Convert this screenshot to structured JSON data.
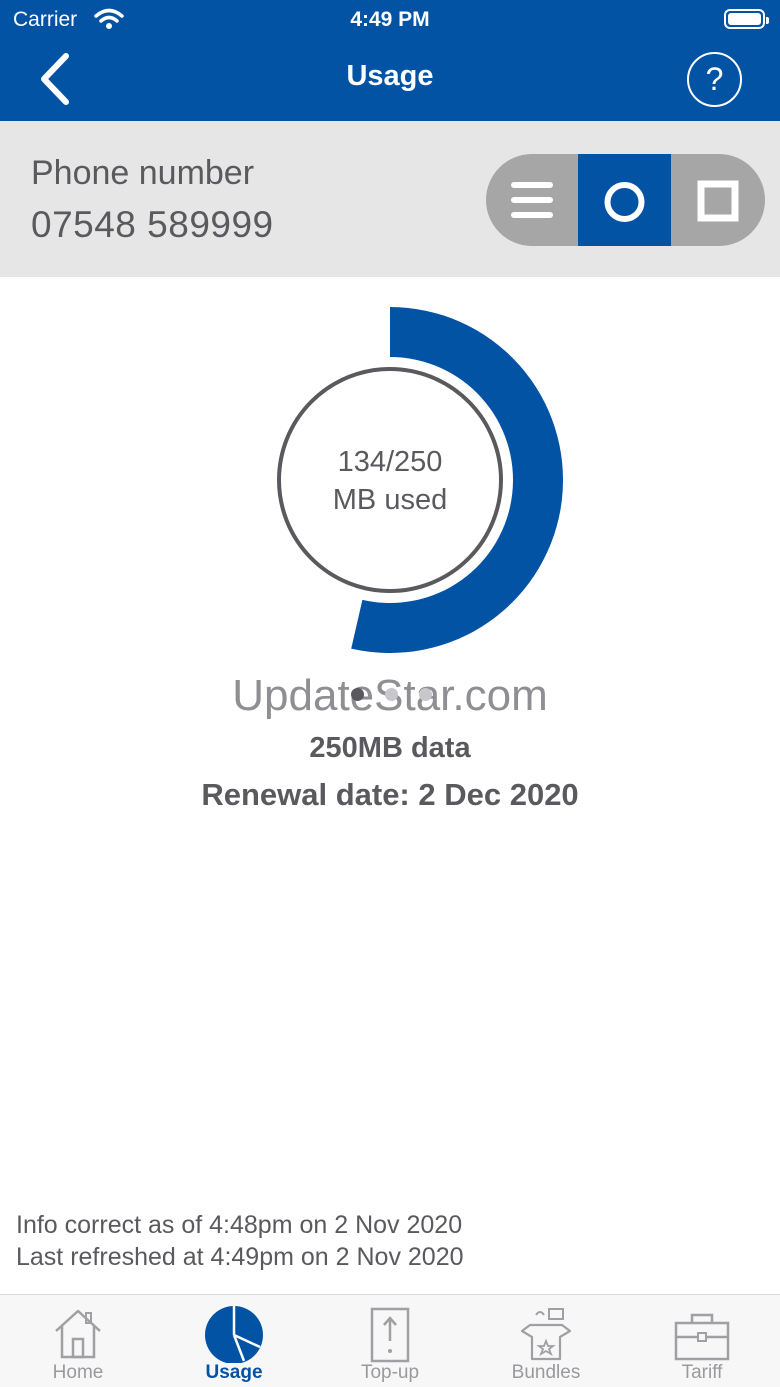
{
  "status_bar": {
    "carrier": "Carrier",
    "time": "4:49 PM"
  },
  "nav": {
    "title": "Usage",
    "back_icon": "chevron-left-icon",
    "help_label": "?"
  },
  "phone": {
    "label": "Phone number",
    "number": "07548 589999"
  },
  "view_toggle": {
    "options": [
      "list-view",
      "circle-view",
      "square-view"
    ],
    "selected": "circle-view"
  },
  "usage": {
    "used": 134,
    "total": 250,
    "fraction_used": 0.536,
    "center_line1": "134/250",
    "center_line2": "MB used",
    "accent_color": "#0353a4"
  },
  "watermark": "UpdateStar.com",
  "pager": {
    "count": 3,
    "active_index": 0
  },
  "plan": {
    "name": "250MB data",
    "renewal": "Renewal date: 2 Dec 2020"
  },
  "info": {
    "correct_as_of": "Info correct as of 4:48pm on 2 Nov 2020",
    "last_refreshed": "Last refreshed at 4:49pm on 2 Nov 2020"
  },
  "tabs": [
    {
      "label": "Home",
      "icon": "home-icon",
      "active": false
    },
    {
      "label": "Usage",
      "icon": "pie-chart-icon",
      "active": true
    },
    {
      "label": "Top-up",
      "icon": "phone-topup-icon",
      "active": false
    },
    {
      "label": "Bundles",
      "icon": "bundles-box-icon",
      "active": false
    },
    {
      "label": "Tariff",
      "icon": "briefcase-icon",
      "active": false
    }
  ],
  "colors": {
    "brand_blue": "#0353a4",
    "header_grey": "#e6e6e6",
    "text_grey": "#5a5a5e"
  }
}
